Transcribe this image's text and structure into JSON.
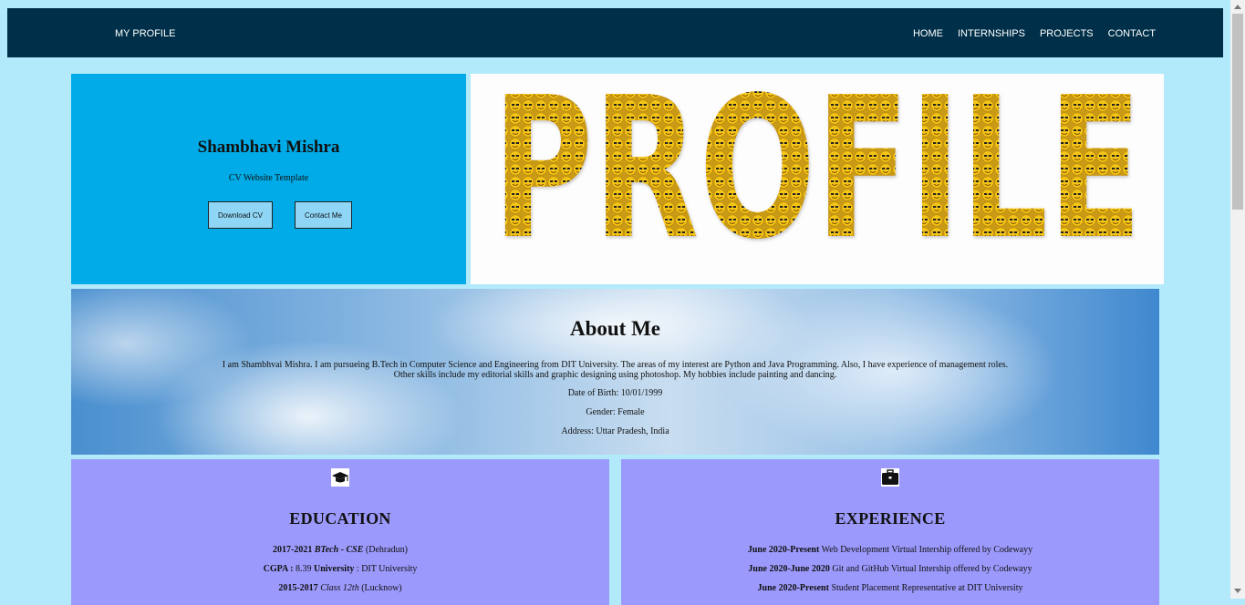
{
  "nav": {
    "brand": "MY PROFILE",
    "links": [
      "HOME",
      "INTERNSHIPS",
      "PROJECTS",
      "CONTACT"
    ]
  },
  "hero": {
    "name": "Shambhavi Mishra",
    "subtitle": "CV Website Template",
    "download_label": "Download CV",
    "contact_label": "Contact Me",
    "banner_text": "PROFILE"
  },
  "about": {
    "title": "About Me",
    "para_line1": "I am Shambhvai Mishra. I am pursueing B.Tech in Computer Science and Engineering from DIT University. The areas of my interest are Python and Java Programming. Also, I have experience of management roles.",
    "para_line2": "Other skills include my editorial skills and graphic designing using photoshop. My hobbies include painting and dancing.",
    "dob": "Date of Birth: 10/01/1999",
    "gender": "Gender: Female",
    "address": "Address: Uttar Pradesh, India"
  },
  "education": {
    "title": "EDUCATION",
    "icon": "graduation-cap-icon",
    "rows": [
      {
        "bold": "2017-2021",
        "italic": "BTech - CSE",
        "rest": "(Dehradun)"
      },
      {
        "b1": "CGPA :",
        "t1": "8.39",
        "b2": "University",
        "t2": ": DIT University"
      },
      {
        "bold": "2015-2017",
        "italic": "Class 12th",
        "rest": "(Lucknow)"
      }
    ]
  },
  "experience": {
    "title": "EXPERIENCE",
    "icon": "briefcase-icon",
    "rows": [
      {
        "bold": "June 2020-Present",
        "rest": "Web Development Virtual Intership offered by Codewayy"
      },
      {
        "bold": "June 2020-June 2020",
        "rest": "Git and GitHub Virtual Intership offered by Codewayy"
      },
      {
        "bold": "June 2020-Present",
        "rest": "Student Placement Representative at DIT University"
      }
    ]
  },
  "colors": {
    "nav_bg": "#003049",
    "page_bg": "#b3eafb",
    "hero_bg": "#00abe7",
    "card_bg": "#9b99fb"
  }
}
